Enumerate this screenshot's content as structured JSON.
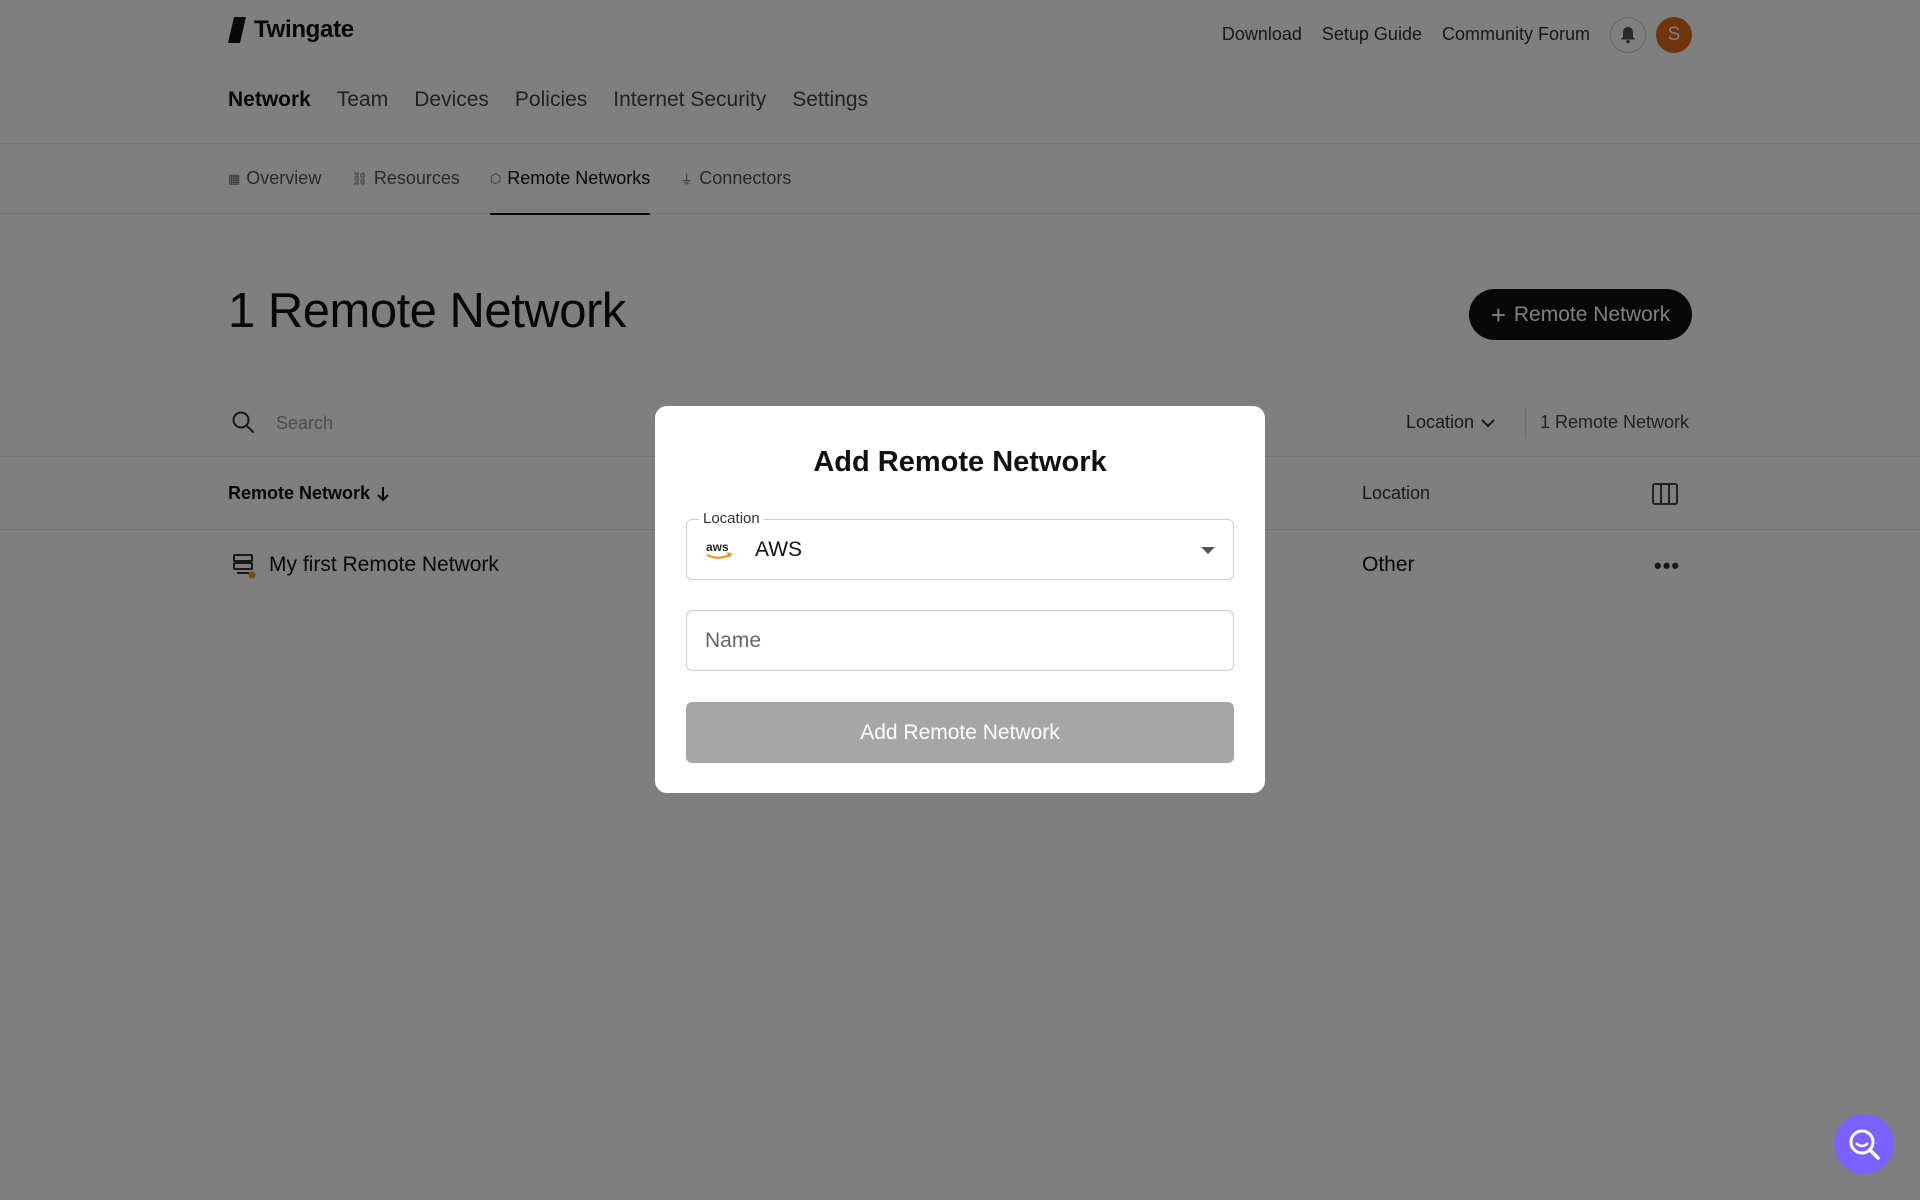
{
  "brand": {
    "name": "Twingate"
  },
  "header": {
    "links": [
      "Download",
      "Setup Guide",
      "Community Forum"
    ],
    "avatar_initial": "S"
  },
  "main_nav": {
    "items": [
      "Network",
      "Team",
      "Devices",
      "Policies",
      "Internet Security",
      "Settings"
    ],
    "active": "Network"
  },
  "sub_nav": {
    "items": [
      "Overview",
      "Resources",
      "Remote Networks",
      "Connectors"
    ],
    "active": "Remote Networks"
  },
  "page": {
    "title": "1 Remote Network",
    "add_button_label": "Remote Network"
  },
  "toolbar": {
    "search_placeholder": "Search",
    "location_filter_label": "Location",
    "count_label": "1 Remote Network"
  },
  "table": {
    "columns": [
      "Remote Network",
      "Location"
    ],
    "rows": [
      {
        "name": "My first Remote Network",
        "location": "Other"
      }
    ]
  },
  "modal": {
    "title": "Add Remote Network",
    "location_label": "Location",
    "location_value": "AWS",
    "location_logo_text": "aws",
    "name_placeholder": "Name",
    "submit_label": "Add Remote Network"
  },
  "colors": {
    "accent": "#111111",
    "avatar": "#e0691f",
    "help_bubble": "#7b61ff",
    "disabled_button": "#a6a6a6"
  },
  "icons": [
    "logo-icon",
    "bell-icon",
    "overview-icon",
    "resources-icon",
    "remote-networks-icon",
    "connectors-icon",
    "plus-icon",
    "search-icon",
    "chevron-down-icon",
    "sort-arrow-icon",
    "columns-icon",
    "server-icon",
    "more-icon",
    "aws-logo",
    "dropdown-caret-icon",
    "help-search-icon"
  ]
}
